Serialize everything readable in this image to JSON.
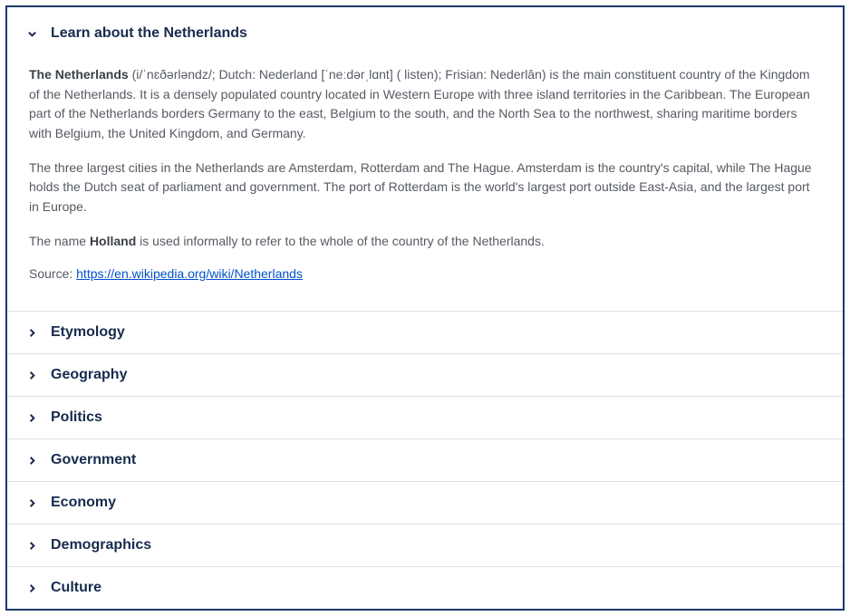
{
  "expanded": {
    "title": "Learn about the Netherlands",
    "para1": {
      "bold": "The Netherlands",
      "rest": " (i/ˈnɛðərləndz/; Dutch: Nederland [ˈneːdərˌlɑnt] ( listen); Frisian: Nederlân) is the main constituent country of the Kingdom of the Netherlands. It is a densely populated country located in Western Europe with three island territories in the Caribbean. The European part of the Netherlands borders Germany to the east, Belgium to the south, and the North Sea to the northwest, sharing maritime borders with Belgium, the United Kingdom, and Germany."
    },
    "para2": "The three largest cities in the Netherlands are Amsterdam, Rotterdam and The Hague. Amsterdam is the country's capital, while The Hague holds the Dutch seat of parliament and government. The port of Rotterdam is the world's largest port outside East-Asia, and the largest port in Europe.",
    "para3": {
      "pre": "The name ",
      "bold": "Holland",
      "post": " is used informally to refer to the whole of the country of the Netherlands."
    },
    "sourceLabel": "Source: ",
    "sourceUrl": "https://en.wikipedia.org/wiki/Netherlands"
  },
  "sections": [
    {
      "title": "Etymology"
    },
    {
      "title": "Geography"
    },
    {
      "title": "Politics"
    },
    {
      "title": "Government"
    },
    {
      "title": "Economy"
    },
    {
      "title": "Demographics"
    },
    {
      "title": "Culture"
    }
  ]
}
